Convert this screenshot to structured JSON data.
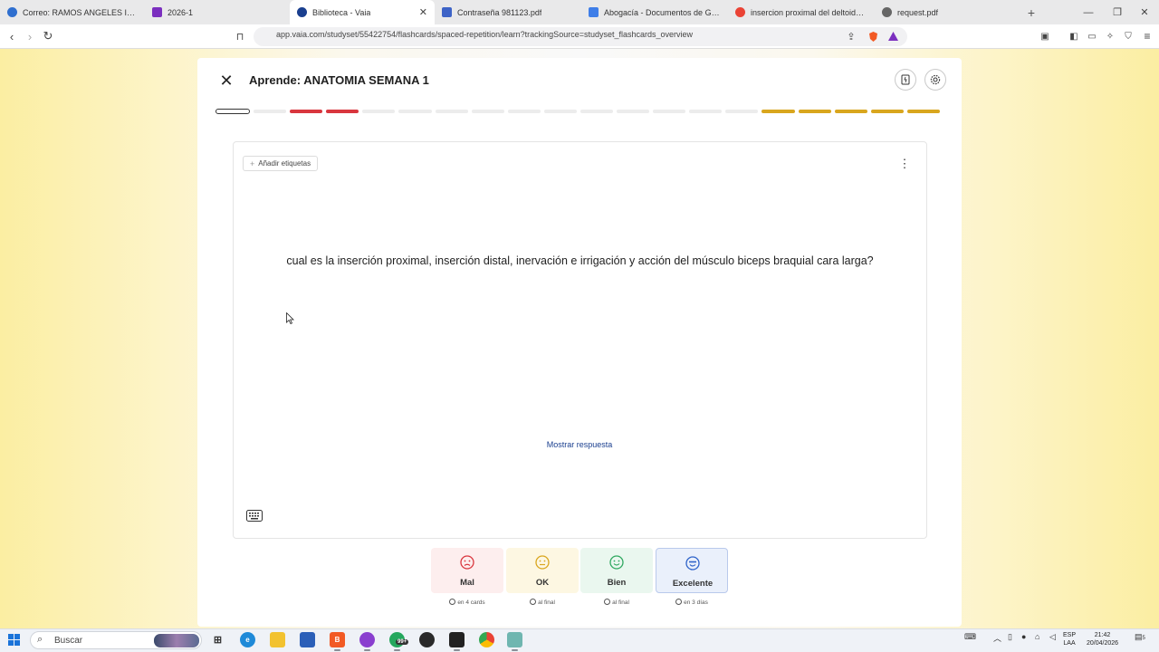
{
  "browser": {
    "tabs": [
      {
        "title": "Correo: RAMOS ANGELES ISABEL CRI",
        "icon": "outlook-icon",
        "color": "#2f6fcf"
      },
      {
        "title": "2026-1",
        "icon": "onenote-icon",
        "color": "#7b2fbf"
      },
      {
        "title": "Biblioteca - Vaia",
        "icon": "vaia-icon",
        "color": "#1a3f8f"
      },
      {
        "title": "Contraseña 981123.pdf",
        "icon": "pdf-icon",
        "color": "#3d63c7"
      },
      {
        "title": "Abogacía - Documentos de Google",
        "icon": "google-docs-icon",
        "color": "#3f7ee8"
      },
      {
        "title": "insercion proximal del deltoides - Bu",
        "icon": "google-icon",
        "color": "#ea4335"
      },
      {
        "title": "request.pdf",
        "icon": "globe-icon",
        "color": "#666666"
      }
    ],
    "url": "app.vaia.com/studyset/55422754/flashcards/spaced-repetition/learn?trackingSource=studyset_flashcards_overview"
  },
  "header": {
    "title": "Aprende: ANATOMIA SEMANA 1"
  },
  "progress": [
    "current",
    "todo",
    "wrong",
    "wrong",
    "todo",
    "todo",
    "todo",
    "todo",
    "todo",
    "todo",
    "todo",
    "todo",
    "todo",
    "todo",
    "todo",
    "good",
    "good",
    "good",
    "good",
    "good"
  ],
  "card": {
    "tag_label": "Añadir etiquetas",
    "question": "cual es la inserción proximal, inserción distal, inervación e irrigación y acción del músculo biceps braquial cara larga?",
    "reveal_label": "Mostrar respuesta"
  },
  "ratings": [
    {
      "label": "Mal",
      "interval": "en 4 cards",
      "color": "#d9363e",
      "bg": "#fdeeee",
      "face": "sad"
    },
    {
      "label": "OK",
      "interval": "al final",
      "color": "#d9a61e",
      "bg": "#fdf7e2",
      "face": "neutral"
    },
    {
      "label": "Bien",
      "interval": "al final",
      "color": "#2fa860",
      "bg": "#eaf7ef",
      "face": "happy"
    },
    {
      "label": "Excelente",
      "interval": "en 3 días",
      "color": "#2d62c9",
      "bg": "#eaf0fb",
      "face": "cool"
    }
  ],
  "taskbar": {
    "search_label": "Buscar",
    "lang": "ESP",
    "region": "LAA",
    "time": "21:42",
    "date": "20/04/2026",
    "whatsapp_badge": "99+",
    "notification_count": "5"
  }
}
